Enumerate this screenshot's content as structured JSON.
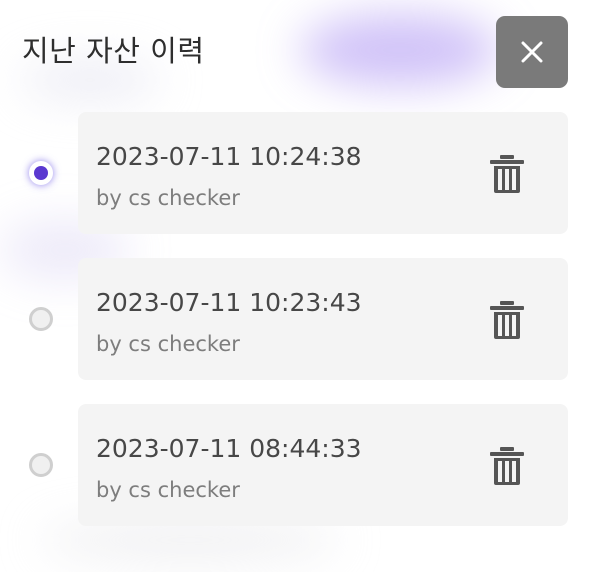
{
  "dialog": {
    "title": "지난 자산 이력",
    "close_icon": "close-icon"
  },
  "history": {
    "selected_index": 0,
    "items": [
      {
        "timestamp": "2023-07-11 10:24:38",
        "author": "by cs checker",
        "selected": true,
        "delete_icon": "trash-icon"
      },
      {
        "timestamp": "2023-07-11 10:23:43",
        "author": "by cs checker",
        "selected": false,
        "delete_icon": "trash-icon"
      },
      {
        "timestamp": "2023-07-11 08:44:33",
        "author": "by cs checker",
        "selected": false,
        "delete_icon": "trash-icon"
      }
    ]
  },
  "colors": {
    "accent": "#5a38d0",
    "close_button_bg": "#7a7a7a",
    "card_bg": "#f4f4f4",
    "icon": "#555555"
  }
}
